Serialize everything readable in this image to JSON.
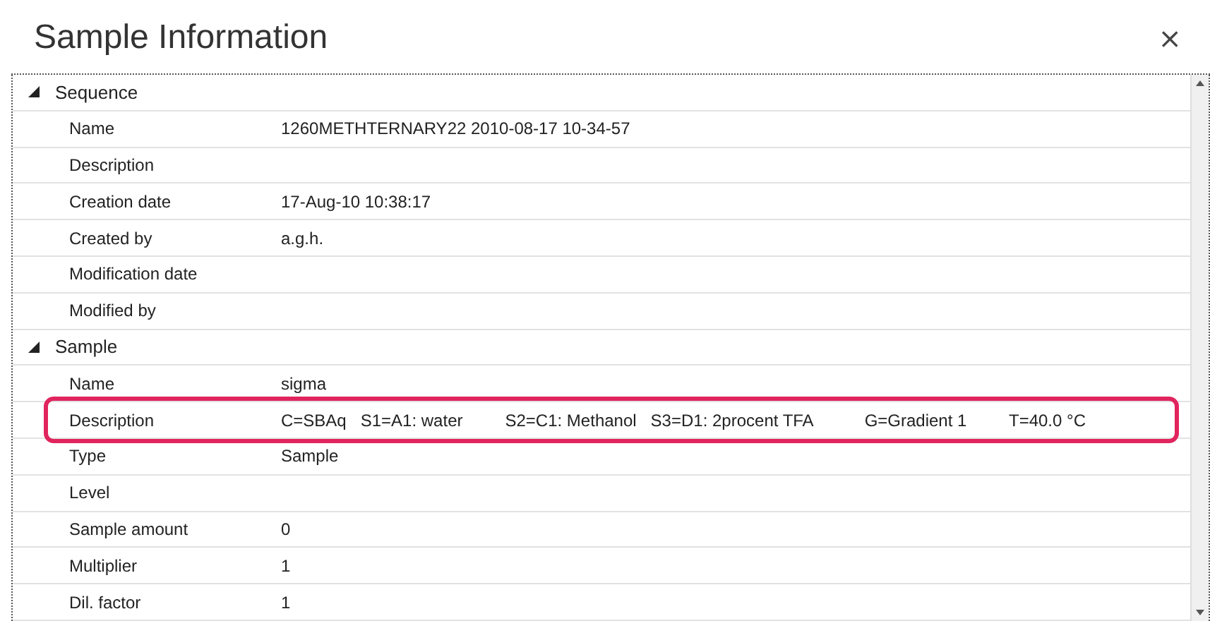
{
  "dialog": {
    "title": "Sample Information",
    "close": "×"
  },
  "groups": [
    {
      "label": "Sequence",
      "expanded": true,
      "rows": [
        {
          "name": "Name",
          "value": "1260METHTERNARY22 2010-08-17 10-34-57",
          "highlighted": false
        },
        {
          "name": "Description",
          "value": "",
          "highlighted": false
        },
        {
          "name": "Creation date",
          "value": "17-Aug-10 10:38:17",
          "highlighted": false
        },
        {
          "name": "Created by",
          "value": "a.g.h.",
          "highlighted": false
        },
        {
          "name": "Modification date",
          "value": "",
          "highlighted": false
        },
        {
          "name": "Modified by",
          "value": "",
          "highlighted": false
        }
      ]
    },
    {
      "label": "Sample",
      "expanded": true,
      "rows": [
        {
          "name": "Name",
          "value": "sigma",
          "highlighted": false
        },
        {
          "name": "Description",
          "value": "C=SBAq   S1=A1: water         S2=C1: Methanol   S3=D1: 2procent TFA           G=Gradient 1         T=40.0 °C",
          "highlighted": true
        },
        {
          "name": "Type",
          "value": "Sample",
          "highlighted": false
        },
        {
          "name": "Level",
          "value": "",
          "highlighted": false
        },
        {
          "name": "Sample amount",
          "value": "0",
          "highlighted": false
        },
        {
          "name": "Multiplier",
          "value": "1",
          "highlighted": false
        },
        {
          "name": "Dil. factor",
          "value": "1",
          "highlighted": false
        }
      ]
    }
  ]
}
